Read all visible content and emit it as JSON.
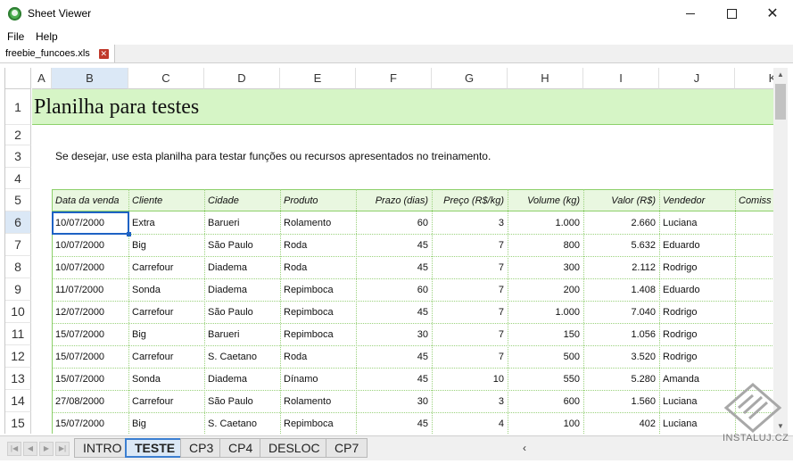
{
  "window": {
    "title": "Sheet Viewer"
  },
  "menu": {
    "file": "File",
    "help": "Help"
  },
  "file_tab": {
    "name": "freebie_funcoes.xls"
  },
  "columns": [
    "A",
    "B",
    "C",
    "D",
    "E",
    "F",
    "G",
    "H",
    "I",
    "J",
    "K"
  ],
  "rows": [
    "1",
    "2",
    "3",
    "4",
    "5",
    "6",
    "7",
    "8",
    "9",
    "10",
    "11",
    "12",
    "13",
    "14",
    "15"
  ],
  "sheet": {
    "title": "Planilha para testes",
    "subtitle": "Se desejar, use esta planilha para testar funções ou recursos apresentados no treinamento."
  },
  "table": {
    "headers": [
      "Data da venda",
      "Cliente",
      "Cidade",
      "Produto",
      "Prazo (dias)",
      "Preço (R$/kg)",
      "Volume (kg)",
      "Valor (R$)",
      "Vendedor",
      "Comiss"
    ],
    "rows": [
      [
        "10/07/2000",
        "Extra",
        "Barueri",
        "Rolamento",
        "60",
        "3",
        "1.000",
        "2.660",
        "Luciana"
      ],
      [
        "10/07/2000",
        "Big",
        "São Paulo",
        "Roda",
        "45",
        "7",
        "800",
        "5.632",
        "Eduardo"
      ],
      [
        "10/07/2000",
        "Carrefour",
        "Diadema",
        "Roda",
        "45",
        "7",
        "300",
        "2.112",
        "Rodrigo"
      ],
      [
        "11/07/2000",
        "Sonda",
        "Diadema",
        "Repimboca",
        "60",
        "7",
        "200",
        "1.408",
        "Eduardo"
      ],
      [
        "12/07/2000",
        "Carrefour",
        "São Paulo",
        "Repimboca",
        "45",
        "7",
        "1.000",
        "7.040",
        "Rodrigo"
      ],
      [
        "15/07/2000",
        "Big",
        "Barueri",
        "Repimboca",
        "30",
        "7",
        "150",
        "1.056",
        "Rodrigo"
      ],
      [
        "15/07/2000",
        "Carrefour",
        "S. Caetano",
        "Roda",
        "45",
        "7",
        "500",
        "3.520",
        "Rodrigo"
      ],
      [
        "15/07/2000",
        "Sonda",
        "Diadema",
        "Dínamo",
        "45",
        "10",
        "550",
        "5.280",
        "Amanda"
      ],
      [
        "27/08/2000",
        "Carrefour",
        "São Paulo",
        "Rolamento",
        "30",
        "3",
        "600",
        "1.560",
        "Luciana"
      ],
      [
        "15/07/2000",
        "Big",
        "S. Caetano",
        "Repimboca",
        "45",
        "4",
        "100",
        "402",
        "Luciana"
      ]
    ]
  },
  "sheet_tabs": [
    "INTRO",
    "TESTE",
    "CP3",
    "CP4",
    "DESLOC",
    "CP7"
  ],
  "active_sheet_tab": "TESTE",
  "watermark": {
    "text": "INSTALUJ.CZ"
  },
  "colors": {
    "title_band": "#d6f5c6",
    "accent": "#3c7fd1",
    "grid": "#9bd27d"
  }
}
